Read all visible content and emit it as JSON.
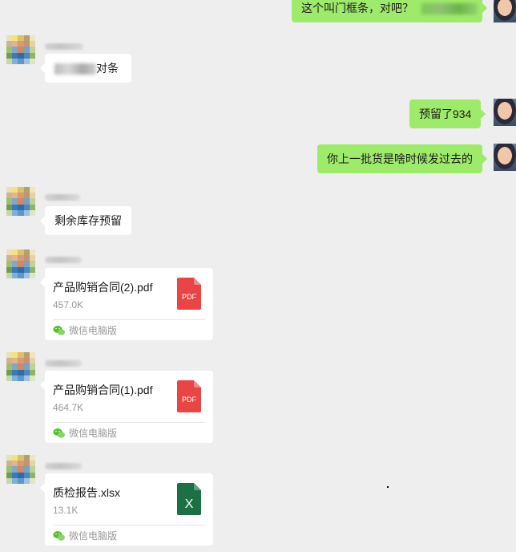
{
  "messages": {
    "m1_text_prefix": "这个叫门框条，对吧？",
    "m2_text_suffix": "对条",
    "m3_text": "预留了934",
    "m4_text": "你上一批货是啥时候发过去的",
    "m5_text": "剩余库存预留"
  },
  "files": [
    {
      "name": "产品购销合同(2).pdf",
      "size": "457.0K",
      "type_label": "PDF",
      "footer": "微信电脑版"
    },
    {
      "name": "产品购销合同(1).pdf",
      "size": "464.7K",
      "type_label": "PDF",
      "footer": "微信电脑版"
    },
    {
      "name": "质检报告.xlsx",
      "size": "13.1K",
      "type_label": "X",
      "footer": "微信电脑版"
    }
  ],
  "colors": {
    "background": "#eeeeee",
    "bubble_self": "#9eea6a",
    "bubble_other": "#ffffff",
    "pdf_red": "#e94545",
    "excel_green": "#1d7044",
    "wechat_green": "#4fc12c"
  }
}
